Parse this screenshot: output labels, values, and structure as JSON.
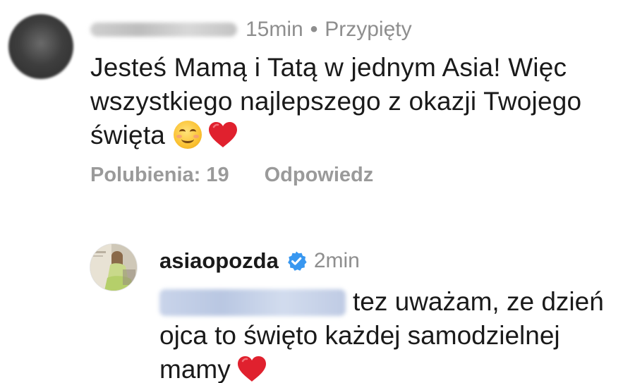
{
  "comment": {
    "time": "15min",
    "separator": "•",
    "pinned_label": "Przypięty",
    "text_lines": [
      "Jesteś Mamą i Tatą w jednym Asia! Więc",
      "wszystkiego najlepszego z okazji Twojego",
      "święta"
    ],
    "likes_label": "Polubienia: 19",
    "reply_label": "Odpowiedz"
  },
  "reply": {
    "username": "asiaopozda",
    "time": "2min",
    "text_lines": [
      "tez uważam, ze dzień",
      "ojca to święto każdej samodzielnej",
      "mamy"
    ]
  },
  "icons": {
    "smile": "smiling-face-emoji-icon",
    "heart": "red-heart-emoji-icon",
    "verified": "verified-badge-icon"
  },
  "colors": {
    "text_primary": "#1a1a1a",
    "text_secondary": "#8e8e8e",
    "verified_blue": "#3897f0",
    "heart_red": "#e0212e"
  }
}
